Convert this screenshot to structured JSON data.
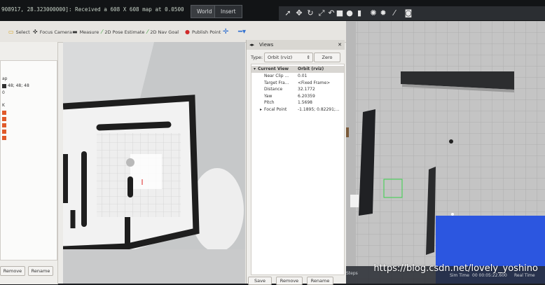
{
  "terminal": {
    "log": "908917, 28.323000000]: Received a 608 X 608 map at 0.0500"
  },
  "gazebo": {
    "tabs": [
      "World",
      "Insert"
    ],
    "toolbar_icons": [
      "select-arrow-icon",
      "translate-icon",
      "rotate-icon",
      "scale-icon",
      "undo-icon",
      "box-icon",
      "sphere-icon",
      "cylinder-icon",
      "sun-icon",
      "spot-light-icon",
      "directional-light-icon",
      "screenshot-icon"
    ],
    "status": {
      "steps_label": "Steps",
      "sim_time_label": "Sim Time",
      "sim_time_value": "00 00:05:22.600",
      "real_time_label": "Real Time"
    }
  },
  "rviz": {
    "toolbar": [
      {
        "label": "Select",
        "icon": "select-icon"
      },
      {
        "label": "Focus Camera",
        "icon": "focus-camera-icon"
      },
      {
        "label": "Measure",
        "icon": "measure-icon"
      },
      {
        "label": "2D Pose Estimate",
        "icon": "pose-estimate-icon"
      },
      {
        "label": "2D Nav Goal",
        "icon": "nav-goal-icon"
      },
      {
        "label": "Publish Point",
        "icon": "publish-point-icon"
      }
    ],
    "displays": {
      "rows": [
        "ap",
        "48; 48; 48",
        "0",
        "K"
      ],
      "footer_buttons": [
        "Remove",
        "Rename"
      ]
    },
    "views": {
      "title": "Views",
      "type_label": "Type:",
      "type_value": "Orbit (rviz)",
      "zero_label": "Zero",
      "current_view_label": "Current View",
      "current_view_value": "Orbit (rviz)",
      "properties": [
        {
          "key": "Near Clip ...",
          "value": "0.01"
        },
        {
          "key": "Target Fra...",
          "value": "<Fixed Frame>"
        },
        {
          "key": "Distance",
          "value": "32.1772"
        },
        {
          "key": "Yaw",
          "value": "6.20359"
        },
        {
          "key": "Pitch",
          "value": "1.5698"
        },
        {
          "key": "Focal Point",
          "value": "-1.1895; 0.82291;..."
        }
      ],
      "footer_buttons": [
        "Save",
        "Remove",
        "Rename"
      ]
    }
  },
  "watermark": "https://blog.csdn.net/lovely_yoshino"
}
